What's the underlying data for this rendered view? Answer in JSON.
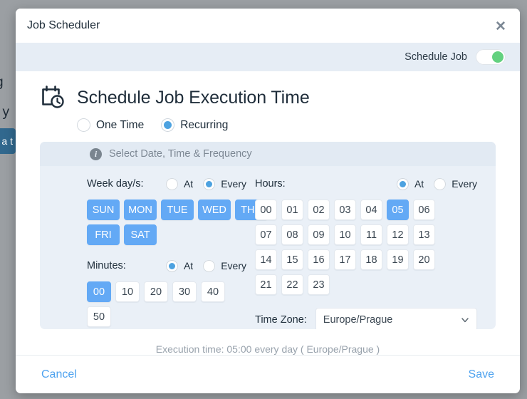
{
  "background": {
    "left_text_fragments": [
      "g",
      "l y"
    ],
    "left_button_fragment": "a t",
    "right_chevron_icon": "chevron-right-icon"
  },
  "modal": {
    "title": "Job Scheduler",
    "close_label": "✕",
    "strip": {
      "label": "Schedule Job",
      "toggle_state": "on",
      "toggle_on_color": "#63d17f"
    },
    "section": {
      "icon": "calendar-clock-icon",
      "title": "Schedule Job Execution Time"
    },
    "mode_options": [
      {
        "label": "One Time",
        "selected": false
      },
      {
        "label": "Recurring",
        "selected": true
      }
    ],
    "panel": {
      "info_icon": "info-icon",
      "header_text": "Select Date, Time & Frequency",
      "weekdays": {
        "label": "Week day/s:",
        "modes": [
          {
            "label": "At",
            "selected": false
          },
          {
            "label": "Every",
            "selected": true
          }
        ],
        "chips": [
          {
            "label": "SUN",
            "selected": true
          },
          {
            "label": "MON",
            "selected": true
          },
          {
            "label": "TUE",
            "selected": true
          },
          {
            "label": "WED",
            "selected": true
          },
          {
            "label": "THU",
            "selected": true
          },
          {
            "label": "FRI",
            "selected": true
          },
          {
            "label": "SAT",
            "selected": true
          }
        ]
      },
      "minutes": {
        "label": "Minutes:",
        "modes": [
          {
            "label": "At",
            "selected": true
          },
          {
            "label": "Every",
            "selected": false
          }
        ],
        "chips": [
          {
            "label": "00",
            "selected": true
          },
          {
            "label": "10",
            "selected": false
          },
          {
            "label": "20",
            "selected": false
          },
          {
            "label": "30",
            "selected": false
          },
          {
            "label": "40",
            "selected": false
          },
          {
            "label": "50",
            "selected": false
          }
        ]
      },
      "hours": {
        "label": "Hours:",
        "modes": [
          {
            "label": "At",
            "selected": true
          },
          {
            "label": "Every",
            "selected": false
          }
        ],
        "chips": [
          {
            "label": "00",
            "selected": false
          },
          {
            "label": "01",
            "selected": false
          },
          {
            "label": "02",
            "selected": false
          },
          {
            "label": "03",
            "selected": false
          },
          {
            "label": "04",
            "selected": false
          },
          {
            "label": "05",
            "selected": true
          },
          {
            "label": "06",
            "selected": false
          },
          {
            "label": "07",
            "selected": false
          },
          {
            "label": "08",
            "selected": false
          },
          {
            "label": "09",
            "selected": false
          },
          {
            "label": "10",
            "selected": false
          },
          {
            "label": "11",
            "selected": false
          },
          {
            "label": "12",
            "selected": false
          },
          {
            "label": "13",
            "selected": false
          },
          {
            "label": "14",
            "selected": false
          },
          {
            "label": "15",
            "selected": false
          },
          {
            "label": "16",
            "selected": false
          },
          {
            "label": "17",
            "selected": false
          },
          {
            "label": "18",
            "selected": false
          },
          {
            "label": "19",
            "selected": false
          },
          {
            "label": "20",
            "selected": false
          },
          {
            "label": "21",
            "selected": false
          },
          {
            "label": "22",
            "selected": false
          },
          {
            "label": "23",
            "selected": false
          }
        ]
      },
      "timezone": {
        "label": "Time Zone:",
        "value": "Europe/Prague",
        "chevron_icon": "chevron-down-icon"
      }
    },
    "execution_summary": "Execution time: 05:00 every day ( Europe/Prague )",
    "footer": {
      "cancel_label": "Cancel",
      "save_label": "Save"
    }
  },
  "colors": {
    "accent_blue": "#63a9f5",
    "radio_blue": "#4da2e0",
    "link_blue": "#4da2ef",
    "toggle_green": "#63d17f",
    "panel_bg": "#eaf0f7",
    "panel_header_bg": "#e2eaf3",
    "strip_bg": "#e6edf5"
  }
}
